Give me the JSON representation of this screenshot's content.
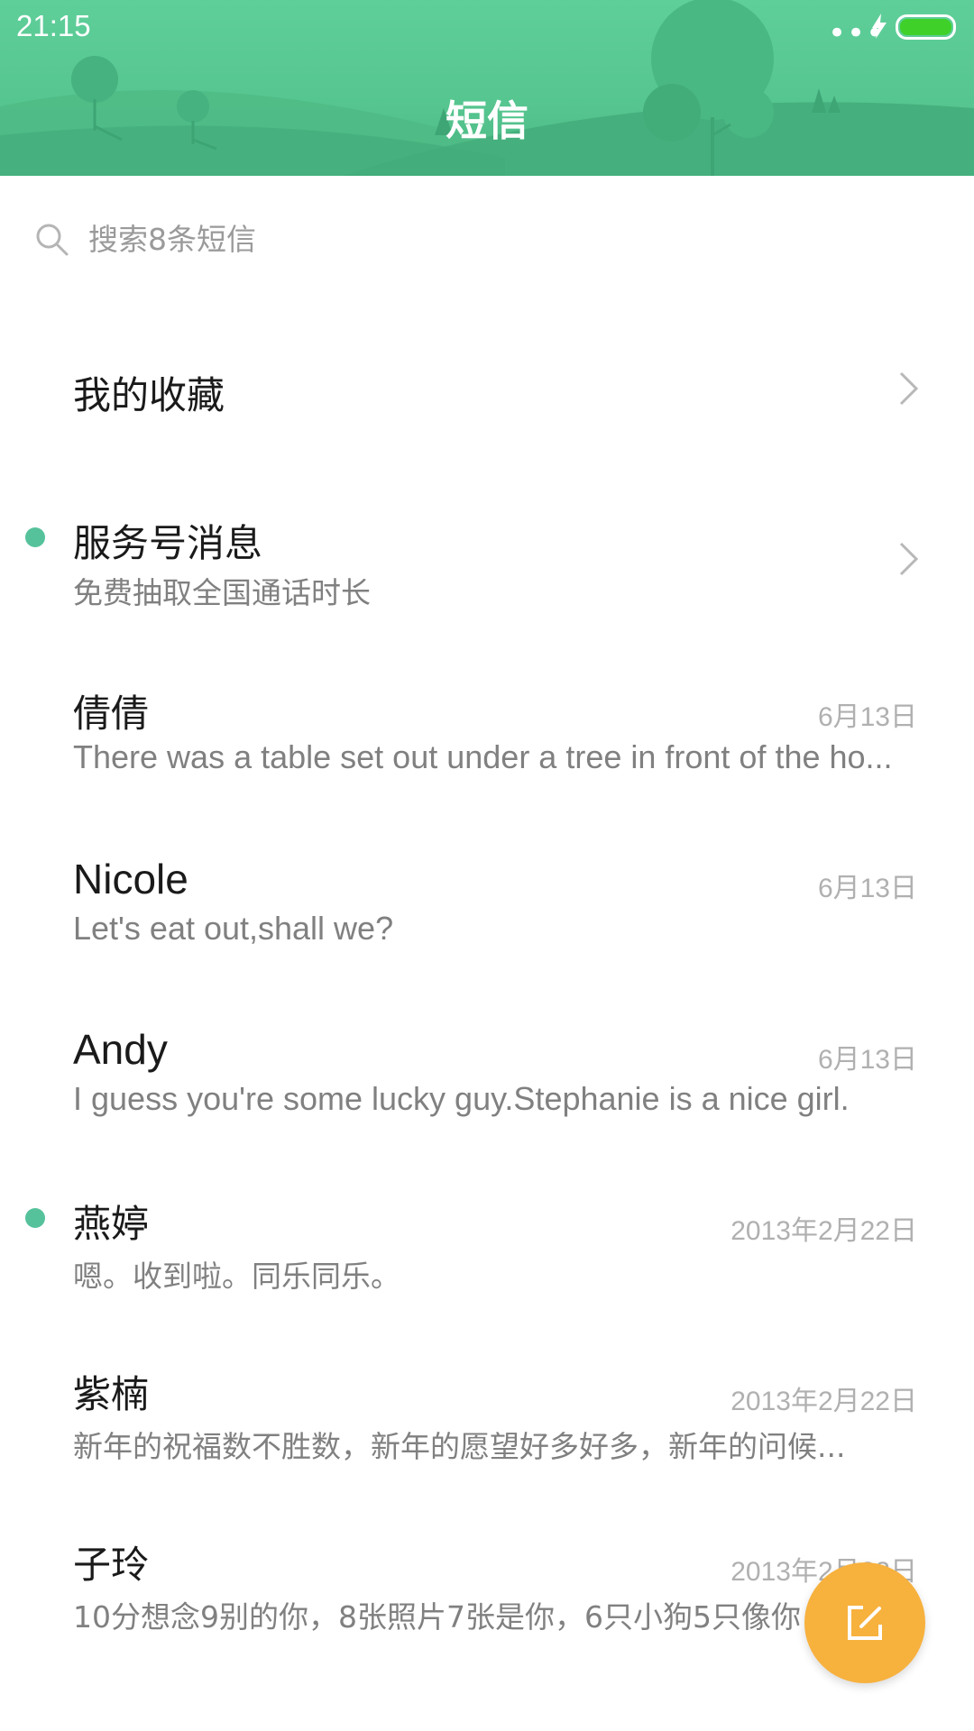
{
  "status_bar": {
    "time": "21:15",
    "dots": "•••",
    "icons": [
      "more-dots-icon",
      "charging-bolt-icon",
      "battery-icon"
    ]
  },
  "header": {
    "title": "短信"
  },
  "search": {
    "placeholder": "搜索8条短信"
  },
  "favorites": {
    "label": "我的收藏"
  },
  "service": {
    "name": "服务号消息",
    "preview": "免费抽取全国通话时长",
    "unread": true
  },
  "conversations": [
    {
      "name": "倩倩",
      "date": "6月13日",
      "preview": "There was a table set out under a tree in front of the ho...",
      "unread": false
    },
    {
      "name": "Nicole",
      "date": "6月13日",
      "preview": "Let's eat out,shall we?",
      "unread": false
    },
    {
      "name": "Andy",
      "date": "6月13日",
      "preview": "I guess you're some lucky guy.Stephanie is a nice girl.",
      "unread": false
    },
    {
      "name": "燕婷",
      "date": "2013年2月22日",
      "preview": "嗯。收到啦。同乐同乐。",
      "unread": true
    },
    {
      "name": "紫楠",
      "date": "2013年2月22日",
      "preview": "新年的祝福数不胜数，新年的愿望好多好多，新年的问候...",
      "unread": false
    },
    {
      "name": "子玲",
      "date": "2013年2月22日",
      "preview": "10分想念9别的你，8张照片7张是你，6只小狗5只像你",
      "unread": false
    }
  ],
  "fab": {
    "icon": "compose-icon"
  },
  "colors": {
    "header_green": "#56c58f",
    "unread_dot": "#56c29c",
    "fab_orange": "#f7b13d"
  }
}
